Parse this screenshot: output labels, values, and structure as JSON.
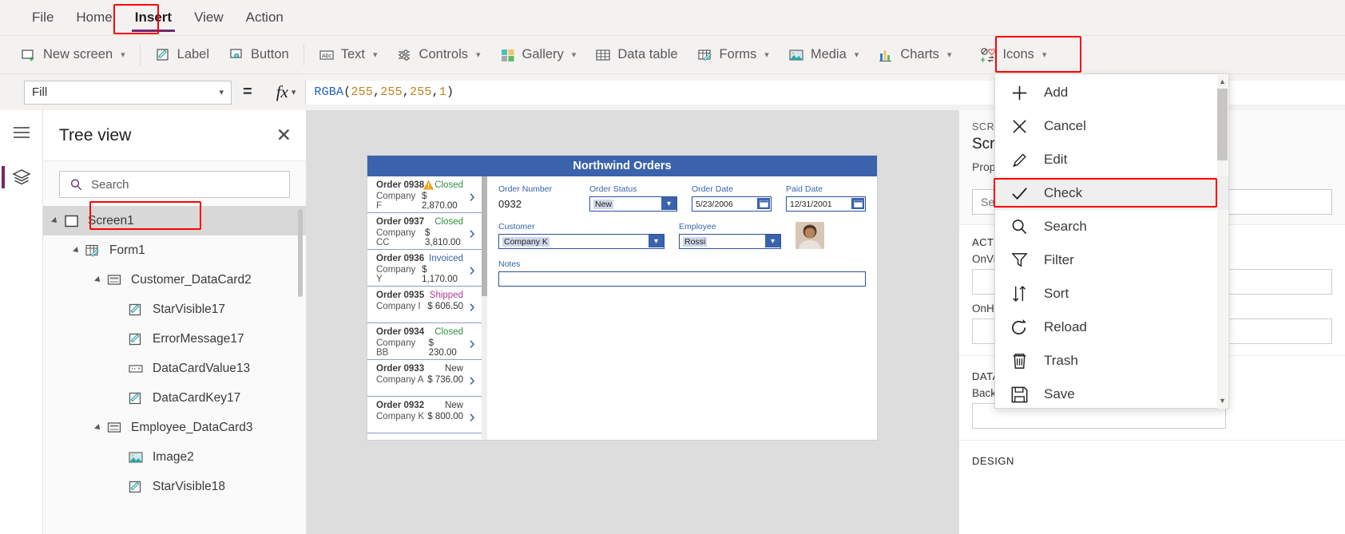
{
  "menubar": {
    "items": [
      {
        "label": "File",
        "active": false
      },
      {
        "label": "Home",
        "active": false
      },
      {
        "label": "Insert",
        "active": true
      },
      {
        "label": "View",
        "active": false
      },
      {
        "label": "Action",
        "active": false
      }
    ]
  },
  "ribbon": {
    "items": [
      {
        "label": "New screen",
        "icon": "new-screen-icon",
        "caret": true
      },
      {
        "label": "Label",
        "icon": "label-icon",
        "caret": false
      },
      {
        "label": "Button",
        "icon": "button-icon",
        "caret": false
      },
      {
        "label": "Text",
        "icon": "text-abc-icon",
        "caret": true
      },
      {
        "label": "Controls",
        "icon": "controls-sliders-icon",
        "caret": true
      },
      {
        "label": "Gallery",
        "icon": "gallery-grid-icon",
        "caret": true
      },
      {
        "label": "Data table",
        "icon": "data-table-icon",
        "caret": false
      },
      {
        "label": "Forms",
        "icon": "forms-icon",
        "caret": true
      },
      {
        "label": "Media",
        "icon": "media-image-icon",
        "caret": true
      },
      {
        "label": "Charts",
        "icon": "charts-bar-icon",
        "caret": true
      },
      {
        "label": "Icons",
        "icon": "icons-shapes-icon",
        "caret": true,
        "highlighted": true
      }
    ]
  },
  "formula_bar": {
    "property": "Fill",
    "equals": "=",
    "fx_label": "fx",
    "formula_tokens": [
      {
        "text": "RGBA",
        "type": "fn"
      },
      {
        "text": "(",
        "type": "pun"
      },
      {
        "text": "255",
        "type": "num"
      },
      {
        "text": ", ",
        "type": "pun"
      },
      {
        "text": "255",
        "type": "num"
      },
      {
        "text": ", ",
        "type": "pun"
      },
      {
        "text": "255",
        "type": "num"
      },
      {
        "text": ", ",
        "type": "pun"
      },
      {
        "text": "1",
        "type": "num"
      },
      {
        "text": ")",
        "type": "pun"
      }
    ]
  },
  "tree_view": {
    "title": "Tree view",
    "close_label": "✕",
    "search_placeholder": "Search",
    "nodes": [
      {
        "label": "Screen1",
        "depth": 0,
        "icon": "screen-icon",
        "expander": true,
        "selected": true
      },
      {
        "label": "Form1",
        "depth": 1,
        "icon": "form-icon",
        "expander": true,
        "selected": false
      },
      {
        "label": "Customer_DataCard2",
        "depth": 2,
        "icon": "datacard-icon",
        "expander": true,
        "selected": false
      },
      {
        "label": "StarVisible17",
        "depth": 3,
        "icon": "label-pencil-icon",
        "expander": false,
        "selected": false
      },
      {
        "label": "ErrorMessage17",
        "depth": 3,
        "icon": "label-pencil-icon",
        "expander": false,
        "selected": false
      },
      {
        "label": "DataCardValue13",
        "depth": 3,
        "icon": "dropdown-icon",
        "expander": false,
        "selected": false
      },
      {
        "label": "DataCardKey17",
        "depth": 3,
        "icon": "label-pencil-icon",
        "expander": false,
        "selected": false
      },
      {
        "label": "Employee_DataCard3",
        "depth": 2,
        "icon": "datacard-icon",
        "expander": true,
        "selected": false
      },
      {
        "label": "Image2",
        "depth": 3,
        "icon": "image-icon",
        "expander": false,
        "selected": false
      },
      {
        "label": "StarVisible18",
        "depth": 3,
        "icon": "label-pencil-icon",
        "expander": false,
        "selected": false
      }
    ]
  },
  "canvas": {
    "app_title": "Northwind Orders",
    "gallery": [
      {
        "order": "Order 0938",
        "company": "Company F",
        "status": "Closed",
        "amount": "$ 2,870.00",
        "warning": true
      },
      {
        "order": "Order 0937",
        "company": "Company CC",
        "status": "Closed",
        "amount": "$ 3,810.00",
        "warning": false
      },
      {
        "order": "Order 0936",
        "company": "Company Y",
        "status": "Invoiced",
        "amount": "$ 1,170.00",
        "warning": false
      },
      {
        "order": "Order 0935",
        "company": "Company I",
        "status": "Shipped",
        "amount": "$ 606.50",
        "warning": false
      },
      {
        "order": "Order 0934",
        "company": "Company BB",
        "status": "Closed",
        "amount": "$ 230.00",
        "warning": false
      },
      {
        "order": "Order 0933",
        "company": "Company A",
        "status": "New",
        "amount": "$ 736.00",
        "warning": false
      },
      {
        "order": "Order 0932",
        "company": "Company K",
        "status": "New",
        "amount": "$ 800.00",
        "warning": false
      }
    ],
    "status_colors": {
      "Closed": "#2f8f3e",
      "Invoiced": "#3a63ac",
      "Shipped": "#b0399c",
      "New": "#3b3a39"
    },
    "form": {
      "order_number_label": "Order Number",
      "order_number_value": "0932",
      "order_status_label": "Order Status",
      "order_status_value": "New",
      "order_date_label": "Order Date",
      "order_date_value": "5/23/2006",
      "paid_date_label": "Paid Date",
      "paid_date_value": "12/31/2001",
      "customer_label": "Customer",
      "customer_value": "Company K",
      "employee_label": "Employee",
      "employee_value": "Rossi",
      "notes_label": "Notes",
      "notes_value": ""
    }
  },
  "properties_panel": {
    "kicker": "SCREEN",
    "name": "Screen",
    "sub": "Properties",
    "search_placeholder": "Se",
    "sections": [
      {
        "title": "ACTION",
        "fields": [
          {
            "label": "OnVi",
            "value": ""
          },
          {
            "label": "OnHi",
            "value": ""
          }
        ]
      },
      {
        "title": "DATA",
        "fields": [
          {
            "label": "BackgroundImage",
            "value": ""
          }
        ]
      },
      {
        "title": "DESIGN",
        "fields": []
      }
    ]
  },
  "icons_menu": {
    "items": [
      {
        "label": "Add",
        "icon": "plus-icon",
        "highlighted": false
      },
      {
        "label": "Cancel",
        "icon": "x-icon",
        "highlighted": false
      },
      {
        "label": "Edit",
        "icon": "pencil-icon",
        "highlighted": false
      },
      {
        "label": "Check",
        "icon": "check-icon",
        "highlighted": true
      },
      {
        "label": "Search",
        "icon": "magnifier-icon",
        "highlighted": false
      },
      {
        "label": "Filter",
        "icon": "funnel-icon",
        "highlighted": false
      },
      {
        "label": "Sort",
        "icon": "sort-arrows-icon",
        "highlighted": false
      },
      {
        "label": "Reload",
        "icon": "refresh-icon",
        "highlighted": false
      },
      {
        "label": "Trash",
        "icon": "trash-icon",
        "highlighted": false
      },
      {
        "label": "Save",
        "icon": "floppy-icon",
        "highlighted": false
      }
    ],
    "scroll_up": "▲",
    "scroll_down": "▼"
  },
  "highlight_color": "#ff0000",
  "accent_color": "#742774"
}
